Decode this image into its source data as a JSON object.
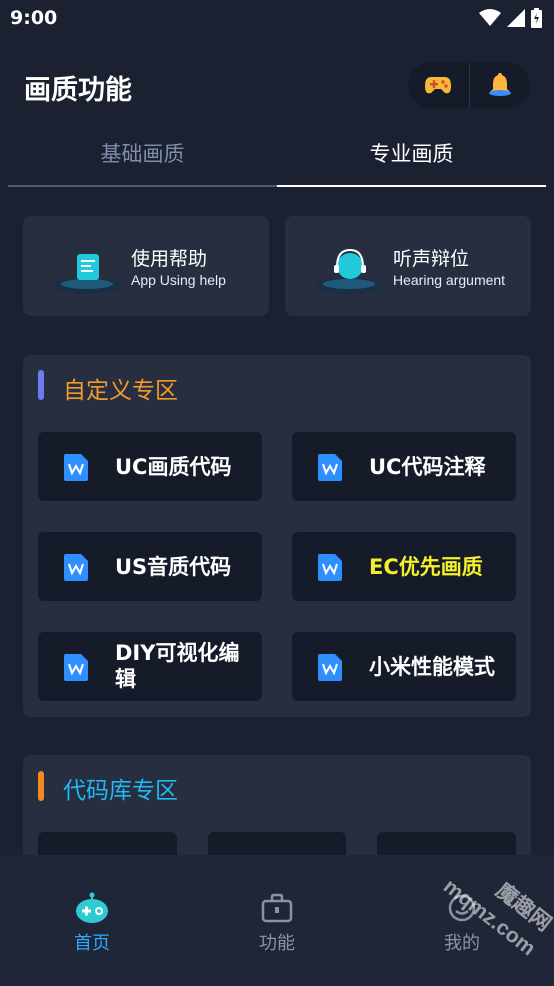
{
  "status": {
    "time": "9:00"
  },
  "header": {
    "title": "画质功能",
    "icons": [
      "gamepad-icon",
      "bell-icon"
    ]
  },
  "tabs": [
    {
      "label": "基础画质",
      "active": false
    },
    {
      "label": "专业画质",
      "active": true
    }
  ],
  "help_cards": [
    {
      "title": "使用帮助",
      "subtitle": "App Using help"
    },
    {
      "title": "听声辩位",
      "subtitle": "Hearing argument"
    }
  ],
  "custom_section": {
    "title": "自定义专区",
    "title_color": "#f39a2b",
    "bar_color": "#6c7cf5",
    "buttons": [
      {
        "label": "UC画质代码"
      },
      {
        "label": "UC代码注释"
      },
      {
        "label": "US音质代码"
      },
      {
        "label": "EC优先画质",
        "color": "#f4f02a"
      },
      {
        "label": "DIY可视化编辑"
      },
      {
        "label": "小米性能模式"
      }
    ]
  },
  "code_section": {
    "title": "代码库专区",
    "title_color": "#23b7f5",
    "bar_color": "#f38a1f"
  },
  "bottom_nav": [
    {
      "label": "首页",
      "active": true
    },
    {
      "label": "功能",
      "active": false
    },
    {
      "label": "我的",
      "active": false
    }
  ],
  "watermark": {
    "text1": "魔趣网",
    "text2": "mqmz.com"
  },
  "colors": {
    "background": "#1b2131",
    "card": "#262e40",
    "button": "#151b28",
    "accent": "#2ea8ff"
  }
}
